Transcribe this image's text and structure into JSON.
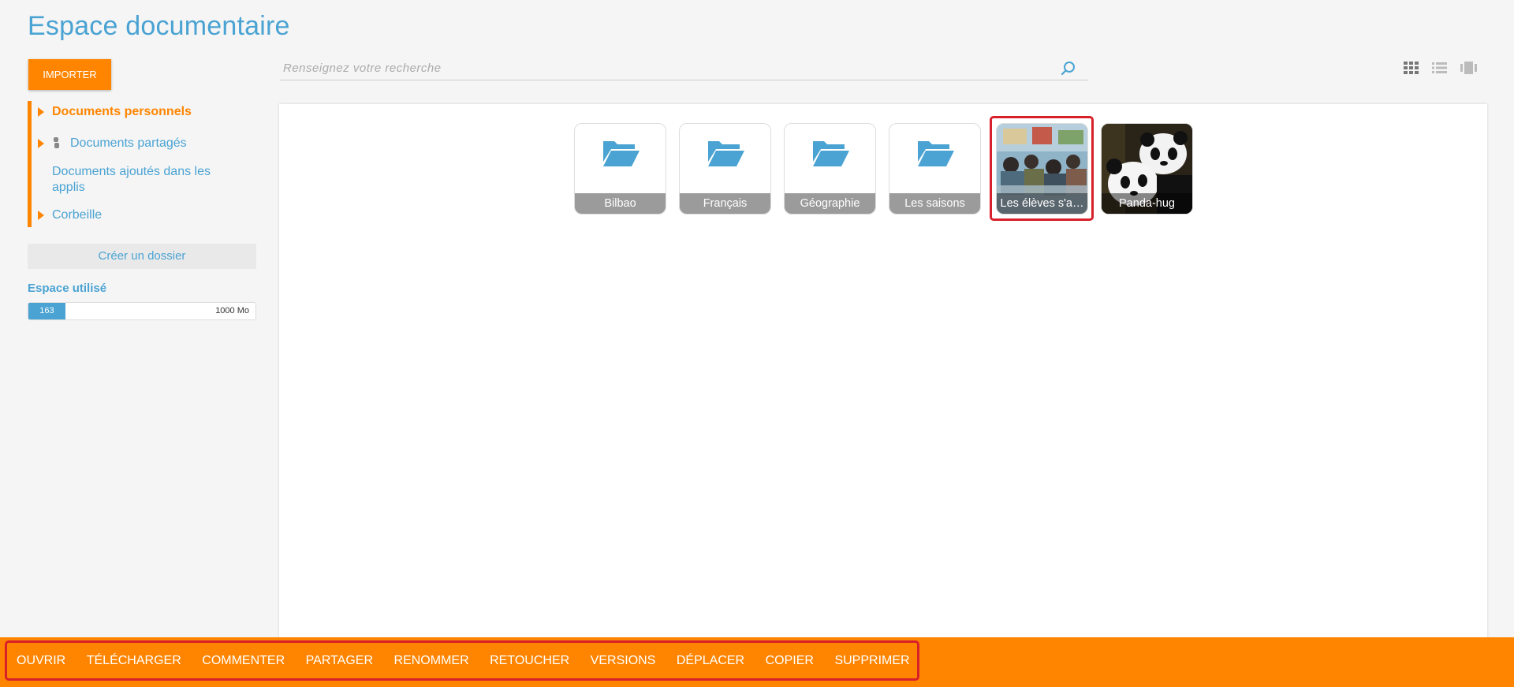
{
  "page": {
    "title": "Espace documentaire"
  },
  "toolbar": {
    "import_label": "IMPORTER"
  },
  "tree": {
    "items": [
      {
        "label": "Documents personnels",
        "icon": "triangle-right-icon",
        "active": true
      },
      {
        "label": "Documents partagés",
        "icon": "share-icon",
        "active": false
      },
      {
        "label": "Documents ajoutés dans les applis",
        "active": false
      },
      {
        "label": "Corbeille",
        "icon": "triangle-right-icon",
        "active": false
      }
    ]
  },
  "create_folder_label": "Créer un dossier",
  "storage": {
    "label": "Espace utilisé",
    "used": "163",
    "max": "1000 Mo",
    "fraction": 0.163
  },
  "search": {
    "placeholder": "Renseignez votre recherche"
  },
  "view_modes": [
    "grid-icon",
    "list-icon",
    "carousel-icon"
  ],
  "items": [
    {
      "label": "Bilbao",
      "type": "folder"
    },
    {
      "label": "Français",
      "type": "folder"
    },
    {
      "label": "Géographie",
      "type": "folder"
    },
    {
      "label": "Les saisons",
      "type": "folder"
    },
    {
      "label": "Les élèves s'a…",
      "type": "image",
      "selected": true
    },
    {
      "label": "Panda-hug",
      "type": "image",
      "selected": false
    }
  ],
  "actions": [
    "OUVRIR",
    "TÉLÉCHARGER",
    "COMMENTER",
    "PARTAGER",
    "RENOMMER",
    "RETOUCHER",
    "VERSIONS",
    "DÉPLACER",
    "COPIER",
    "SUPPRIMER"
  ],
  "colors": {
    "accent": "#ff8500",
    "link": "#4aa3d3",
    "selection": "#d8202a"
  }
}
